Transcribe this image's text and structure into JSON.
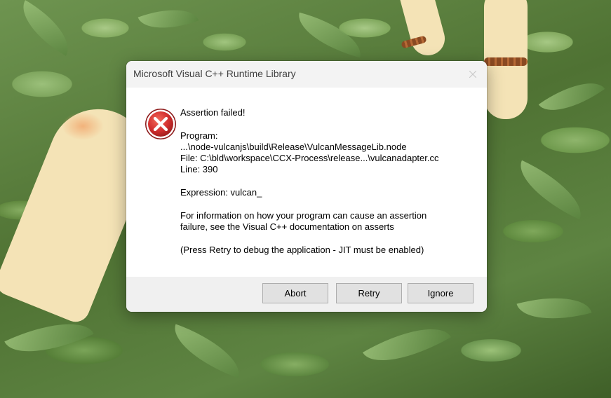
{
  "dialog": {
    "title": "Microsoft Visual C++ Runtime Library",
    "icon": "error-icon",
    "message": {
      "heading": "Assertion failed!",
      "program_label": "Program:",
      "program_path": "...\\node-vulcanjs\\build\\Release\\VulcanMessageLib.node",
      "file": "File: C:\\bld\\workspace\\CCX-Process\\release...\\vulcanadapter.cc",
      "line": "Line: 390",
      "expression": "Expression: vulcan_",
      "info_line1": "For information on how your program can cause an assertion",
      "info_line2": "failure, see the Visual C++ documentation on asserts",
      "hint": "(Press Retry to debug the application - JIT must be enabled)"
    },
    "buttons": {
      "abort": "Abort",
      "retry": "Retry",
      "ignore": "Ignore"
    }
  },
  "colors": {
    "error_red": "#d32f2f",
    "focus_blue": "#0078d7",
    "footer_bg": "#f0f0f0",
    "titlebar_bg": "#f3f3f3"
  }
}
